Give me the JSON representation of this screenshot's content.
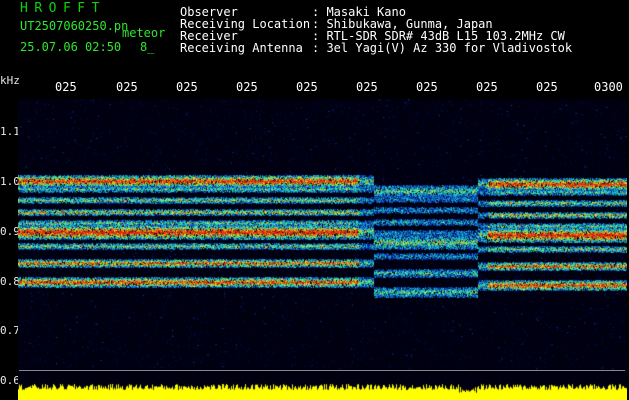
{
  "header": {
    "logo": "HROFFT",
    "file_name": "UT2507060250.pn",
    "meteor_label": "meteor",
    "datetime": "25.07.06 02:50",
    "count_label": "8_",
    "fields": [
      {
        "label": "Observer",
        "value": ": Masaki Kano"
      },
      {
        "label": "Receiving Location",
        "value": ": Shibukawa, Gunma, Japan"
      },
      {
        "label": "Receiver",
        "value": ": RTL-SDR SDR# 43dB L15 103.2MHz CW"
      },
      {
        "label": "Receiving Antenna",
        "value": ": 3el Yagi(V) Az 330 for Vladivostok"
      }
    ]
  },
  "axis": {
    "y_unit": "kHz",
    "y_ticks": [
      "1.1",
      "1.0",
      "0.9",
      "0.8",
      "0.7",
      "0.6"
    ],
    "x_ticks": [
      "025",
      "025",
      "025",
      "025",
      "025",
      "025",
      "025",
      "025",
      "025",
      "0300"
    ]
  },
  "colors": {
    "background": "#000000",
    "plot_bg": "#000011",
    "logo": "#0bd40b",
    "text": "#ffffff",
    "meter": "#ffff00"
  }
}
